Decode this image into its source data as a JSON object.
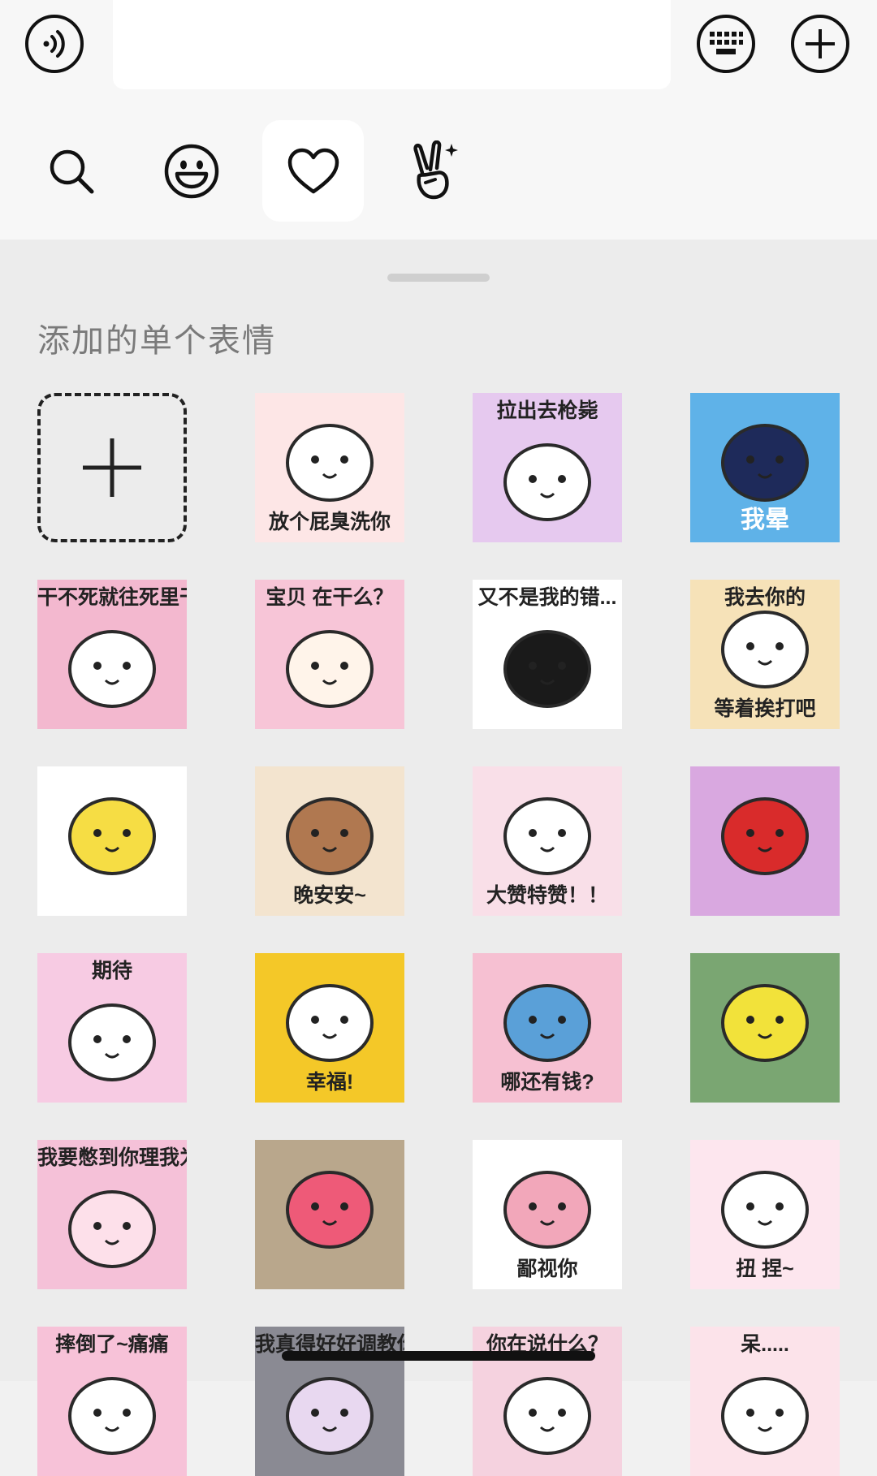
{
  "input": {
    "value": "",
    "placeholder": ""
  },
  "tabs": [
    {
      "name": "search",
      "icon": "search-icon",
      "active": false
    },
    {
      "name": "emoji",
      "icon": "smiley-icon",
      "active": false
    },
    {
      "name": "favorites",
      "icon": "heart-icon",
      "active": true
    },
    {
      "name": "gestures",
      "icon": "victory-hand-icon",
      "active": false
    }
  ],
  "section": {
    "title": "添加的单个表情"
  },
  "stickers": [
    {
      "caption": "放个屁臭洗你",
      "bg": "#fde6e6",
      "fg": "#ffffff"
    },
    {
      "caption": "拉出去枪毙",
      "bg": "#e6c9ef",
      "fg": "#ffffff"
    },
    {
      "caption": "我晕",
      "bg": "#5fb2e8",
      "fg": "#1e2a5a"
    },
    {
      "caption": "干不死就往死里干",
      "bg": "#f3b8cf",
      "fg": "#ffffff"
    },
    {
      "caption": "宝贝 在干么？",
      "bg": "#f7c5d7",
      "fg": "#fff4ea"
    },
    {
      "caption": "又不是我的错...",
      "bg": "#ffffff",
      "fg": "#1a1a1a"
    },
    {
      "caption_top": "我去你的",
      "caption_bottom": "等着挨打吧",
      "bg": "#f6e2b8",
      "fg": "#ffffff"
    },
    {
      "caption": "",
      "bg": "#ffffff",
      "fg": "#f6dd44"
    },
    {
      "caption": "晚安安~",
      "bg": "#f3e4cf",
      "fg": "#b07850"
    },
    {
      "caption": "大赞特赞！！",
      "bg": "#f9dfe8",
      "fg": "#ffffff"
    },
    {
      "caption": "",
      "bg": "#d9a8e0",
      "fg": "#d92b2b"
    },
    {
      "caption": "期待",
      "bg": "#f7cbe3",
      "fg": "#ffffff"
    },
    {
      "caption": "幸福!",
      "bg": "#f4c828",
      "fg": "#ffffff"
    },
    {
      "caption": "哪还有钱?",
      "bg": "#f6c0d2",
      "fg": "#5aa0d8"
    },
    {
      "caption": "",
      "bg": "#7aa672",
      "fg": "#f2e23a"
    },
    {
      "caption": "我要憋到你理我为止",
      "bg": "#f5c1d8",
      "fg": "#fde0ea"
    },
    {
      "caption": "",
      "bg": "#b9a78c",
      "fg": "#ee5a78"
    },
    {
      "caption": "鄙视你",
      "bg": "#ffffff",
      "fg": "#f2a7ba"
    },
    {
      "caption": "扭 捏~",
      "bg": "#fde6ee",
      "fg": "#ffffff"
    },
    {
      "caption": "摔倒了~痛痛",
      "bg": "#f7c2d8",
      "fg": "#ffffff"
    },
    {
      "caption": "我真得好好调教你了",
      "bg": "#8a8a93",
      "fg": "#e8d8f0"
    },
    {
      "caption": "你在说什么？",
      "bg": "#f5d2df",
      "fg": "#ffffff"
    },
    {
      "caption": "呆.....",
      "bg": "#fce3ea",
      "fg": "#ffffff"
    }
  ]
}
